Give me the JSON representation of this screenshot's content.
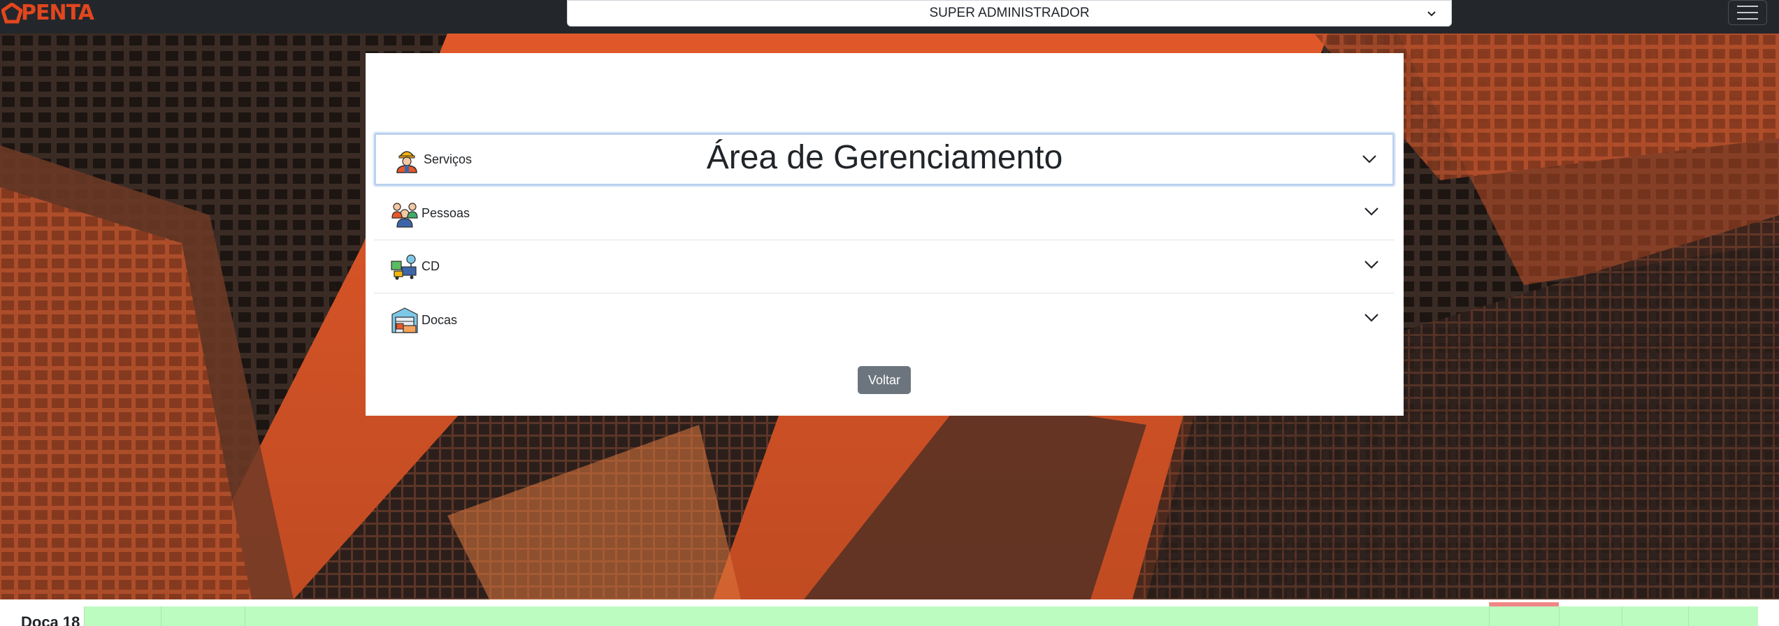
{
  "navbar": {
    "logo_text": "PENTA",
    "role_selected": "SUPER ADMINISTRADOR",
    "icons": {
      "logo": "penta-logo-icon",
      "chevron": "chevron-down-icon",
      "menu": "hamburger-menu-icon"
    }
  },
  "page": {
    "title": "Área de Gerenciamento"
  },
  "accordion": {
    "items": [
      {
        "label": "Serviços",
        "icon": "worker-icon"
      },
      {
        "label": "Pessoas",
        "icon": "people-icon"
      },
      {
        "label": "CD",
        "icon": "distribution-center-icon"
      },
      {
        "label": "Docas",
        "icon": "dock-warehouse-icon"
      }
    ]
  },
  "actions": {
    "back_label": "Voltar"
  },
  "bottom_strip": {
    "dock_label": "Doca 18"
  },
  "colors": {
    "navbar_bg": "#23272b",
    "brand": "#e2461e",
    "button_secondary": "#6c757d",
    "dock_free": "#bdfcc0",
    "dock_alert": "#f08585"
  }
}
